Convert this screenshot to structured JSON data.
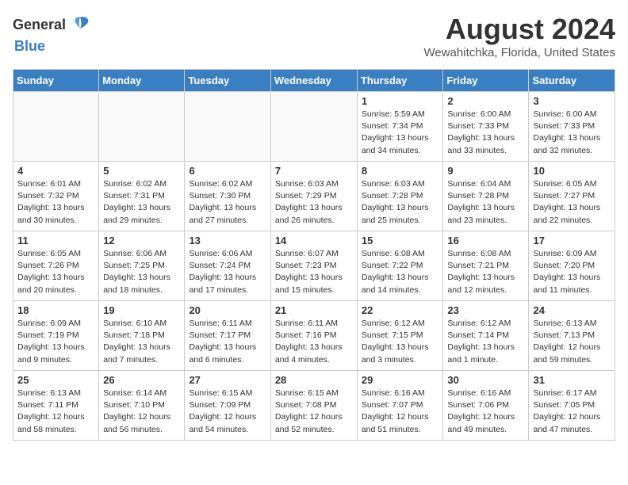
{
  "header": {
    "logo_general": "General",
    "logo_blue": "Blue",
    "month_year": "August 2024",
    "location": "Wewahitchka, Florida, United States"
  },
  "columns": [
    "Sunday",
    "Monday",
    "Tuesday",
    "Wednesday",
    "Thursday",
    "Friday",
    "Saturday"
  ],
  "weeks": [
    [
      {
        "day": "",
        "info": ""
      },
      {
        "day": "",
        "info": ""
      },
      {
        "day": "",
        "info": ""
      },
      {
        "day": "",
        "info": ""
      },
      {
        "day": "1",
        "info": "Sunrise: 5:59 AM\nSunset: 7:34 PM\nDaylight: 13 hours\nand 34 minutes."
      },
      {
        "day": "2",
        "info": "Sunrise: 6:00 AM\nSunset: 7:33 PM\nDaylight: 13 hours\nand 33 minutes."
      },
      {
        "day": "3",
        "info": "Sunrise: 6:00 AM\nSunset: 7:33 PM\nDaylight: 13 hours\nand 32 minutes."
      }
    ],
    [
      {
        "day": "4",
        "info": "Sunrise: 6:01 AM\nSunset: 7:32 PM\nDaylight: 13 hours\nand 30 minutes."
      },
      {
        "day": "5",
        "info": "Sunrise: 6:02 AM\nSunset: 7:31 PM\nDaylight: 13 hours\nand 29 minutes."
      },
      {
        "day": "6",
        "info": "Sunrise: 6:02 AM\nSunset: 7:30 PM\nDaylight: 13 hours\nand 27 minutes."
      },
      {
        "day": "7",
        "info": "Sunrise: 6:03 AM\nSunset: 7:29 PM\nDaylight: 13 hours\nand 26 minutes."
      },
      {
        "day": "8",
        "info": "Sunrise: 6:03 AM\nSunset: 7:28 PM\nDaylight: 13 hours\nand 25 minutes."
      },
      {
        "day": "9",
        "info": "Sunrise: 6:04 AM\nSunset: 7:28 PM\nDaylight: 13 hours\nand 23 minutes."
      },
      {
        "day": "10",
        "info": "Sunrise: 6:05 AM\nSunset: 7:27 PM\nDaylight: 13 hours\nand 22 minutes."
      }
    ],
    [
      {
        "day": "11",
        "info": "Sunrise: 6:05 AM\nSunset: 7:26 PM\nDaylight: 13 hours\nand 20 minutes."
      },
      {
        "day": "12",
        "info": "Sunrise: 6:06 AM\nSunset: 7:25 PM\nDaylight: 13 hours\nand 18 minutes."
      },
      {
        "day": "13",
        "info": "Sunrise: 6:06 AM\nSunset: 7:24 PM\nDaylight: 13 hours\nand 17 minutes."
      },
      {
        "day": "14",
        "info": "Sunrise: 6:07 AM\nSunset: 7:23 PM\nDaylight: 13 hours\nand 15 minutes."
      },
      {
        "day": "15",
        "info": "Sunrise: 6:08 AM\nSunset: 7:22 PM\nDaylight: 13 hours\nand 14 minutes."
      },
      {
        "day": "16",
        "info": "Sunrise: 6:08 AM\nSunset: 7:21 PM\nDaylight: 13 hours\nand 12 minutes."
      },
      {
        "day": "17",
        "info": "Sunrise: 6:09 AM\nSunset: 7:20 PM\nDaylight: 13 hours\nand 11 minutes."
      }
    ],
    [
      {
        "day": "18",
        "info": "Sunrise: 6:09 AM\nSunset: 7:19 PM\nDaylight: 13 hours\nand 9 minutes."
      },
      {
        "day": "19",
        "info": "Sunrise: 6:10 AM\nSunset: 7:18 PM\nDaylight: 13 hours\nand 7 minutes."
      },
      {
        "day": "20",
        "info": "Sunrise: 6:11 AM\nSunset: 7:17 PM\nDaylight: 13 hours\nand 6 minutes."
      },
      {
        "day": "21",
        "info": "Sunrise: 6:11 AM\nSunset: 7:16 PM\nDaylight: 13 hours\nand 4 minutes."
      },
      {
        "day": "22",
        "info": "Sunrise: 6:12 AM\nSunset: 7:15 PM\nDaylight: 13 hours\nand 3 minutes."
      },
      {
        "day": "23",
        "info": "Sunrise: 6:12 AM\nSunset: 7:14 PM\nDaylight: 13 hours\nand 1 minute."
      },
      {
        "day": "24",
        "info": "Sunrise: 6:13 AM\nSunset: 7:13 PM\nDaylight: 12 hours\nand 59 minutes."
      }
    ],
    [
      {
        "day": "25",
        "info": "Sunrise: 6:13 AM\nSunset: 7:11 PM\nDaylight: 12 hours\nand 58 minutes."
      },
      {
        "day": "26",
        "info": "Sunrise: 6:14 AM\nSunset: 7:10 PM\nDaylight: 12 hours\nand 56 minutes."
      },
      {
        "day": "27",
        "info": "Sunrise: 6:15 AM\nSunset: 7:09 PM\nDaylight: 12 hours\nand 54 minutes."
      },
      {
        "day": "28",
        "info": "Sunrise: 6:15 AM\nSunset: 7:08 PM\nDaylight: 12 hours\nand 52 minutes."
      },
      {
        "day": "29",
        "info": "Sunrise: 6:16 AM\nSunset: 7:07 PM\nDaylight: 12 hours\nand 51 minutes."
      },
      {
        "day": "30",
        "info": "Sunrise: 6:16 AM\nSunset: 7:06 PM\nDaylight: 12 hours\nand 49 minutes."
      },
      {
        "day": "31",
        "info": "Sunrise: 6:17 AM\nSunset: 7:05 PM\nDaylight: 12 hours\nand 47 minutes."
      }
    ]
  ]
}
